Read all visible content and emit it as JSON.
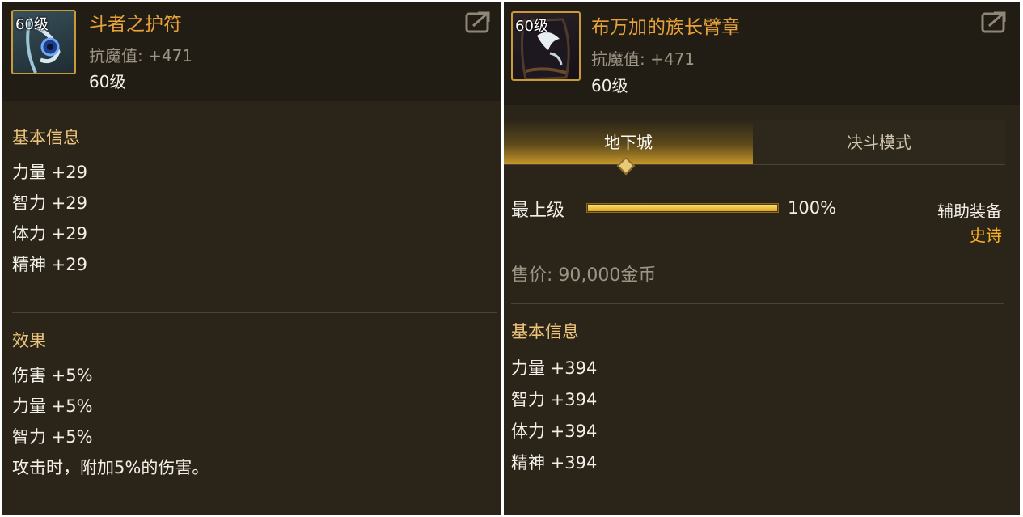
{
  "left_item": {
    "icon_level": "60级",
    "name": "斗者之护符",
    "magic_resist": "抗魔值: +471",
    "level": "60级",
    "basic_info_title": "基本信息",
    "basic_stats": [
      "力量 +29",
      "智力 +29",
      "体力 +29",
      "精神 +29"
    ],
    "effects_title": "效果",
    "effects": [
      "伤害 +5%",
      "力量 +5%",
      "智力 +5%",
      "攻击时，附加5%的伤害。"
    ]
  },
  "right_item": {
    "icon_level": "60级",
    "name": "布万加的族长臂章",
    "magic_resist": "抗魔值: +471",
    "level": "60级",
    "tabs": [
      {
        "label": "地下城",
        "active": true
      },
      {
        "label": "决斗模式",
        "active": false
      }
    ],
    "progress": {
      "label": "最上级",
      "value": 100,
      "text": "100%"
    },
    "equip_type": "辅助装备",
    "rarity": "史诗",
    "price": "售价: 90,000金币",
    "basic_info_title": "基本信息",
    "basic_stats": [
      "力量 +394",
      "智力 +394",
      "体力 +394",
      "精神 +394"
    ]
  },
  "colors": {
    "panel_bg": "#2b2519",
    "item_name": "#e8a23a",
    "section_title": "#ecc37a",
    "rarity_epic": "#ffb023",
    "icon_border": "#c89a38"
  },
  "icons": {
    "share": "share-icon",
    "left_item_icon": "amulet-icon",
    "right_item_icon": "armband-icon"
  }
}
